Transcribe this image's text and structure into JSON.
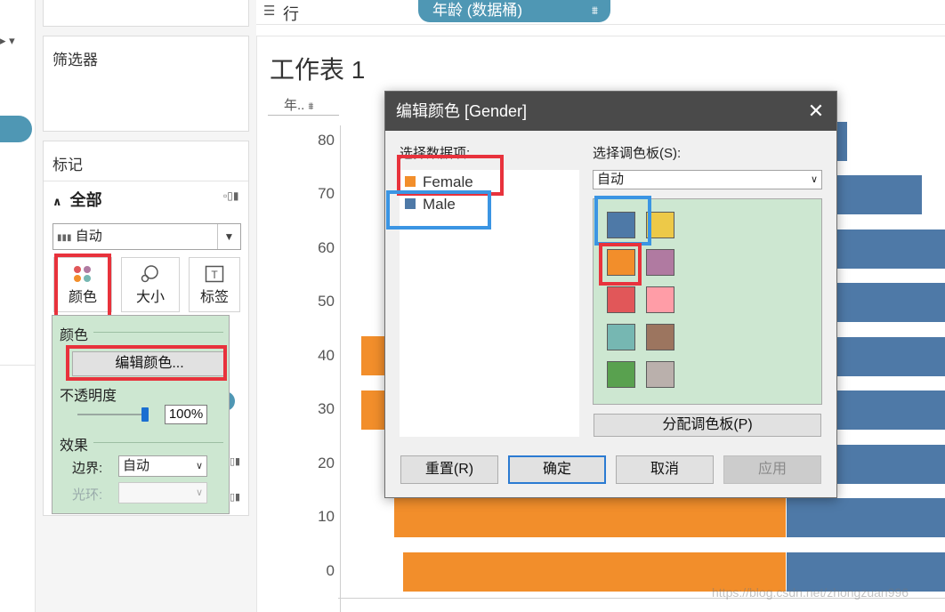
{
  "shelf": {
    "rows_label": "行",
    "pill_label": "年龄 (数据桶)"
  },
  "filters": {
    "title": "筛选器"
  },
  "marks": {
    "title": "标记",
    "all_label": "全部",
    "mark_type": "自动",
    "buttons": {
      "color": "颜色",
      "size": "大小",
      "label": "标签"
    }
  },
  "color_popup": {
    "section_color": "颜色",
    "edit_colors_button": "编辑颜色...",
    "opacity_label": "不透明度",
    "opacity_value": "100%",
    "opacity_fraction": 1.0,
    "effects_label": "效果",
    "border_label": "边界:",
    "border_value": "自动",
    "halo_label": "光环:",
    "halo_value": ""
  },
  "sheet": {
    "title": "工作表 1",
    "y_field_short": "年..",
    "y_ticks": [
      "80",
      "70",
      "60",
      "50",
      "40",
      "30",
      "20",
      "10",
      "0"
    ]
  },
  "dialog": {
    "title": "编辑颜色 [Gender]",
    "data_items_label": "选择数据项:",
    "data_items": [
      {
        "name": "Female",
        "color": "#f28e2b"
      },
      {
        "name": "Male",
        "color": "#4e79a7"
      }
    ],
    "palette_label": "选择调色板(S):",
    "palette_value": "自动",
    "swatches": [
      "#4e79a7",
      "#edc948",
      "#f28e2b",
      "#b07aa1",
      "#e15759",
      "#ff9da7",
      "#76b7b2",
      "#9c755f",
      "#59a14f",
      "#bab0ac"
    ],
    "assign_button": "分配调色板(P)",
    "reset_button": "重置(R)",
    "ok_button": "确定",
    "cancel_button": "取消",
    "apply_button": "应用"
  },
  "watermark": "https://blog.csdn.net/zhongzuan996",
  "colors": {
    "female": "#f28e2b",
    "male": "#4e79a7",
    "accent": "#4f97b4",
    "highlight_red": "#e8323c",
    "highlight_blue": "#3b95e3"
  }
}
